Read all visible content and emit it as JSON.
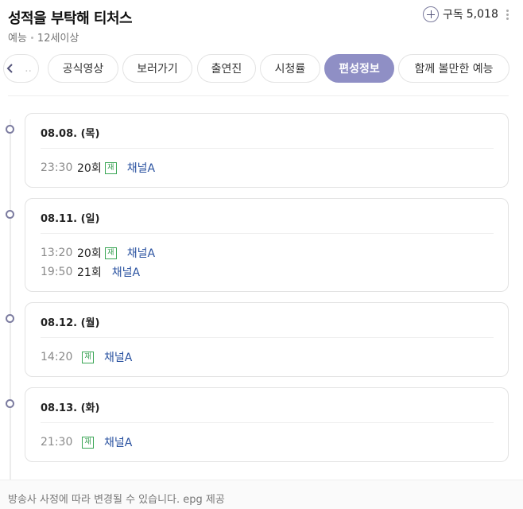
{
  "header": {
    "title": "성적을 부탁해 티처스",
    "genre": "예능",
    "rating": "12세이상",
    "subscribe_label": "구독",
    "subscribe_count": "5,018"
  },
  "tabs": [
    {
      "label": "..",
      "active": false
    },
    {
      "label": "공식영상",
      "active": false
    },
    {
      "label": "보러가기",
      "active": false
    },
    {
      "label": "출연진",
      "active": false
    },
    {
      "label": "시청률",
      "active": false
    },
    {
      "label": "편성정보",
      "active": true
    },
    {
      "label": "함께 볼만한 예능",
      "active": false
    }
  ],
  "schedule": [
    {
      "date": "08.08. (목)",
      "rows": [
        {
          "time": "23:30",
          "episode": "20회",
          "rerun": "재",
          "channel": "채널A"
        }
      ]
    },
    {
      "date": "08.11. (일)",
      "rows": [
        {
          "time": "13:20",
          "episode": "20회",
          "rerun": "재",
          "channel": "채널A"
        },
        {
          "time": "19:50",
          "episode": "21회",
          "rerun": "",
          "channel": "채널A"
        }
      ]
    },
    {
      "date": "08.12. (월)",
      "rows": [
        {
          "time": "14:20",
          "episode": "",
          "rerun": "재",
          "channel": "채널A"
        }
      ]
    },
    {
      "date": "08.13. (화)",
      "rows": [
        {
          "time": "21:30",
          "episode": "",
          "rerun": "재",
          "channel": "채널A"
        }
      ]
    }
  ],
  "footer": {
    "note": "방송사 사정에 따라 변경될 수 있습니다. epg 제공"
  },
  "colors": {
    "accent": "#8f8fc5",
    "channel": "#2a52a0",
    "rerun_badge": "#3aa655"
  }
}
